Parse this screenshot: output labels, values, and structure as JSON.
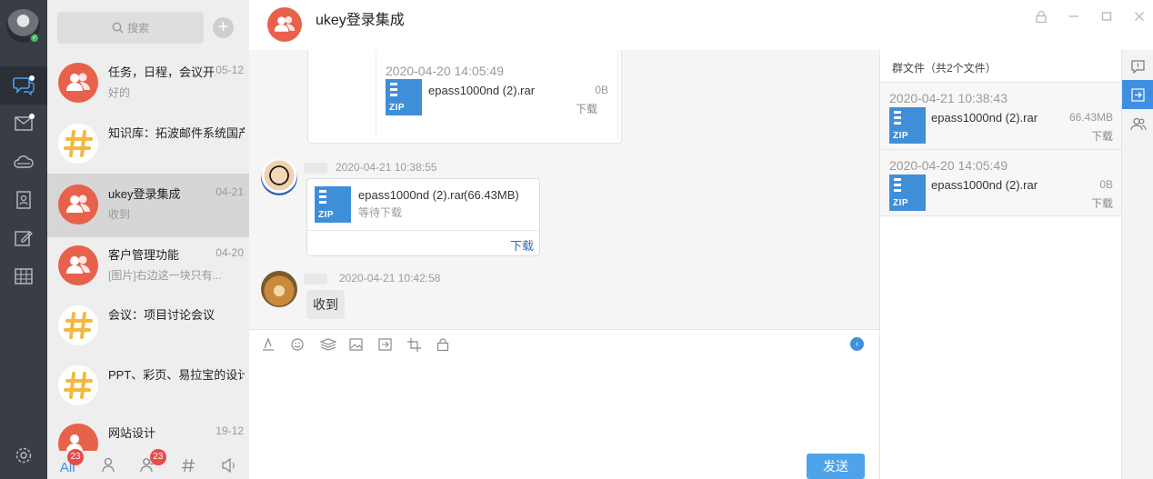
{
  "search": {
    "placeholder": "搜索"
  },
  "conversations": [
    {
      "name": "任务，日程，会议开发",
      "time": "05-12",
      "preview": "好的",
      "avatar": "group-icon"
    },
    {
      "name": "知识库：拓波邮件系统国产化",
      "time": "",
      "preview": "",
      "avatar": "hash-icon"
    },
    {
      "name": "ukey登录集成",
      "time": "04-21",
      "preview": "收到",
      "avatar": "group-icon"
    },
    {
      "name": "客户管理功能",
      "time": "04-20",
      "preview": "[图片]右边这一块只有...",
      "avatar": "group-icon"
    },
    {
      "name": "会议：项目讨论会议",
      "time": "",
      "preview": "",
      "avatar": "hash-icon"
    },
    {
      "name": "PPT、彩页、易拉宝的设计与",
      "time": "",
      "preview": "",
      "avatar": "hash-icon"
    },
    {
      "name": "网站设计",
      "time": "19-12",
      "preview": "",
      "avatar": "group-icon"
    }
  ],
  "bottom_tabs": {
    "all_label": "All",
    "all_badge": "23",
    "groups_badge": "23"
  },
  "chat": {
    "title": "ukey登录集成",
    "forwarded": {
      "time": "2020-04-20 14:05:49",
      "file_name": "epass1000nd (2).rar",
      "file_size": "0B",
      "download": "下载"
    },
    "messages": [
      {
        "time": "2020-04-21 10:38:55",
        "file_name": "epass1000nd (2).rar",
        "file_size": "(66.43MB)",
        "status": "等待下载",
        "download": "下载"
      },
      {
        "time": "2020-04-21 10:42:58",
        "text": "收到"
      }
    ],
    "send_label": "发送"
  },
  "files_panel": {
    "header": "群文件（共2个文件）",
    "files": [
      {
        "time": "2020-04-21 10:38:43",
        "name": "epass1000nd (2).rar",
        "size": "66.43MB",
        "download": "下载"
      },
      {
        "time": "2020-04-20 14:05:49",
        "name": "epass1000nd (2).rar",
        "size": "0B",
        "download": "下载"
      }
    ]
  },
  "colors": {
    "accent": "#3f8fe0",
    "avatar_red": "#e8614b",
    "hash_yellow": "#f4b840",
    "rail": "#393d45"
  }
}
